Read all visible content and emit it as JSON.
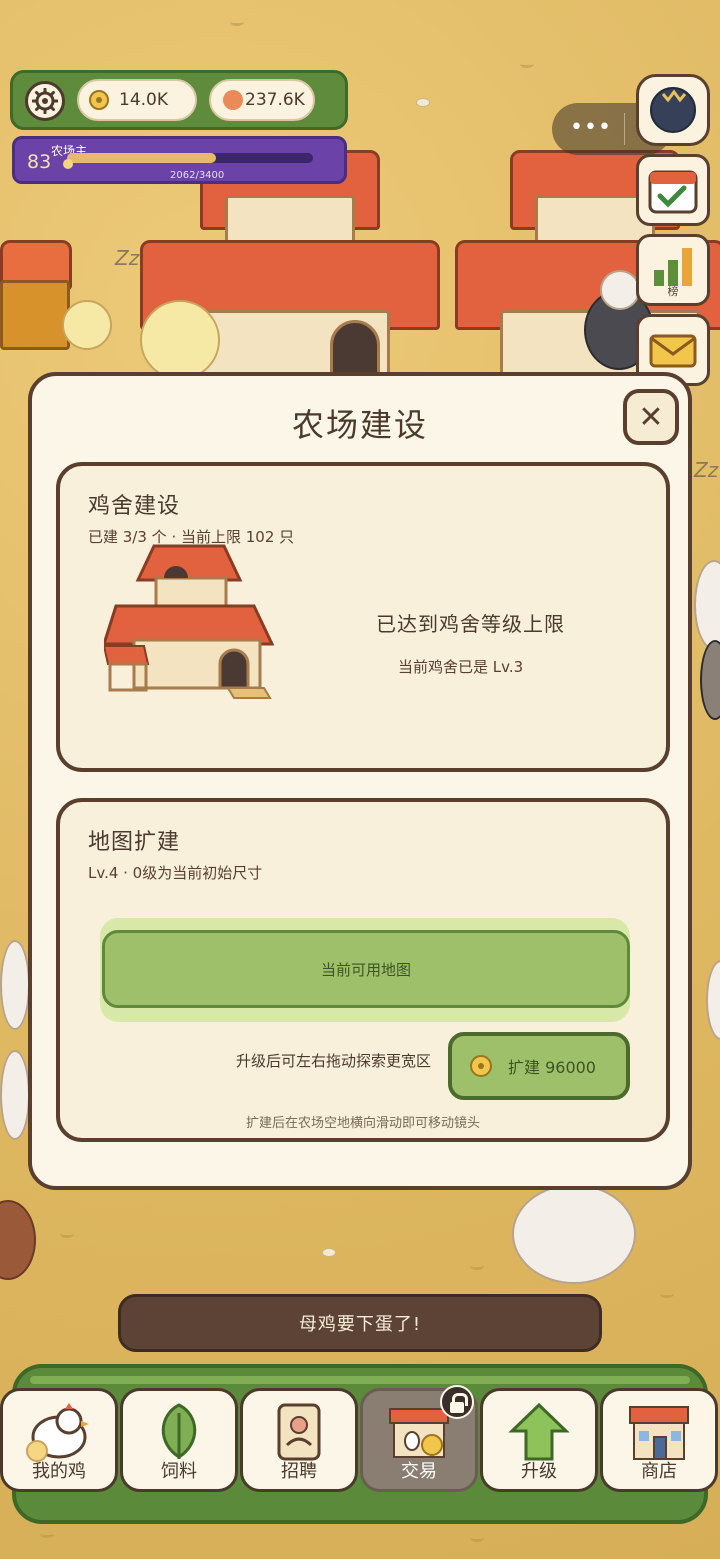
{
  "hud": {
    "coins": "14.0K",
    "eggs": "237.6K",
    "level": "83",
    "level_title": "农场主",
    "xp_text": "2062/3400",
    "xp_progress": 0.606
  },
  "side_buttons": {
    "rank_label": "榜"
  },
  "modal": {
    "title": "农场建设",
    "close_symbol": "✕",
    "coop": {
      "title": "鸡舍建设",
      "subtitle": "已建 3/3 个 · 当前上限 102 只",
      "status": "已达到鸡舍等级上限",
      "status_sub": "当前鸡舍已是 Lv.3"
    },
    "map": {
      "title": "地图扩建",
      "subtitle": "Lv.4 · 0级为当前初始尺寸",
      "current_map_label": "当前可用地图",
      "hint": "升级后可左右拖动探索更宽区",
      "expand_label": "扩建 96000",
      "footer_hint": "扩建后在农场空地横向滑动即可移动镜头"
    }
  },
  "toast": "母鸡要下蛋了!",
  "nav": [
    {
      "label": "我的鸡",
      "icon": "hen-icon"
    },
    {
      "label": "饲料",
      "icon": "leaf-icon"
    },
    {
      "label": "招聘",
      "icon": "badge-icon"
    },
    {
      "label": "交易",
      "icon": "market-icon"
    },
    {
      "label": "升级",
      "icon": "arrow-up-icon"
    },
    {
      "label": "商店",
      "icon": "shop-icon"
    }
  ],
  "colors": {
    "accent_green": "#9ec06a",
    "frame_brown": "#5a3f2e",
    "level_purple": "#6a42a8",
    "background": "#e2bf6a"
  }
}
